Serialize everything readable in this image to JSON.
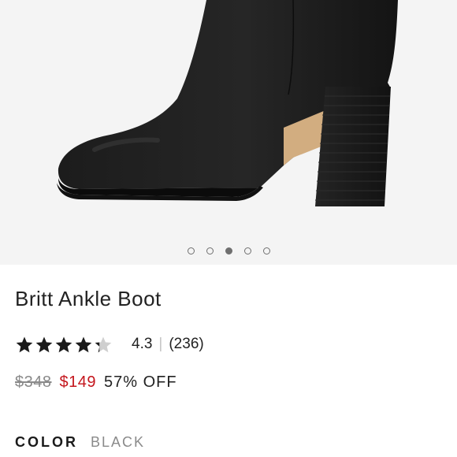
{
  "gallery": {
    "image_name": "black-ankle-boot-photo",
    "slide_count": 5,
    "active_slide": 3
  },
  "product": {
    "title": "Britt Ankle Boot",
    "rating": {
      "stars": 4.3,
      "value_text": "4.3",
      "separator": "|",
      "review_count_text": "(236)"
    },
    "price": {
      "original": "$348",
      "sale": "$149",
      "discount": "57% OFF"
    },
    "color": {
      "label": "COLOR",
      "value": "BLACK"
    }
  },
  "colors": {
    "sale_price": "#c4151c",
    "star_filled": "#1a1a1a",
    "star_empty": "#cfcfcf",
    "muted_text": "#8a8a8a"
  }
}
